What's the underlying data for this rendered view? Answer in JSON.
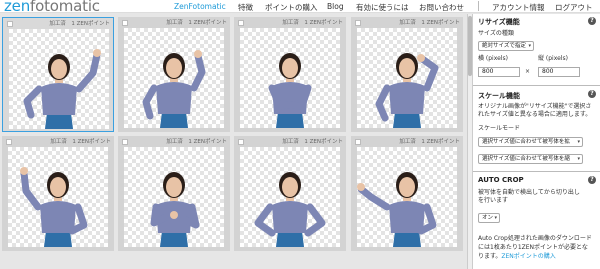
{
  "header": {
    "logo_zen": "zen",
    "logo_rest": "fotomatic",
    "nav": [
      {
        "label": "ZenFotomatic",
        "active": true
      },
      {
        "label": "特徴"
      },
      {
        "label": "ポイントの購入"
      },
      {
        "label": "Blog"
      },
      {
        "label": "有効に使うには"
      },
      {
        "label": "お問い合わせ"
      },
      {
        "label": "アカウント情報"
      },
      {
        "label": "ログアウト"
      }
    ]
  },
  "grid": {
    "cell_label": "加工済　1 ZENポイント",
    "cells": [
      {
        "selected": true,
        "pose": "hand-up-side"
      },
      {
        "selected": false,
        "pose": "hand-up-front"
      },
      {
        "selected": false,
        "pose": "arms-crossed"
      },
      {
        "selected": false,
        "pose": "hand-head"
      },
      {
        "selected": false,
        "pose": "pointing-up"
      },
      {
        "selected": false,
        "pose": "fist-happy"
      },
      {
        "selected": false,
        "pose": "hands-hips"
      },
      {
        "selected": false,
        "pose": "pointing-side"
      }
    ]
  },
  "sidebar": {
    "resize": {
      "title": "リサイズ機能",
      "type_label": "サイズの種類",
      "type_value": "絶対サイズで指定",
      "width_label": "横 (pixels)",
      "height_label": "縦 (pixels)",
      "width_value": "800",
      "height_value": "800",
      "times": "×"
    },
    "scale": {
      "title": "スケール機能",
      "desc1": "オリジナル画像が\"リサイズ機能\"で選択さ",
      "desc2": "れたサイズ値と異なる場合に適用します。",
      "mode_label": "スケールモード",
      "mode1": "選択サイズ値に合わせて被写体を拡",
      "mode2": "選択サイズ値に合わせて被写体を縮"
    },
    "autocrop": {
      "title": "AUTO CROP",
      "desc1": "被写体を自動で検出してから切り出し",
      "desc2": "を行います",
      "value": "オン",
      "note1": "Auto Crop処理された画像のダウンロード",
      "note2": "には1枚あたり1ZENポイントが必要とな",
      "note3_prefix": "ります。",
      "note3_link": "ZENポイントの購入"
    },
    "help_symbol": "?"
  },
  "colors": {
    "accent": "#1f9bd8",
    "shirt": "#7d86b4",
    "pants": "#2f6fa8",
    "hair": "#2a1e18",
    "skin": "#e8c3a6"
  }
}
